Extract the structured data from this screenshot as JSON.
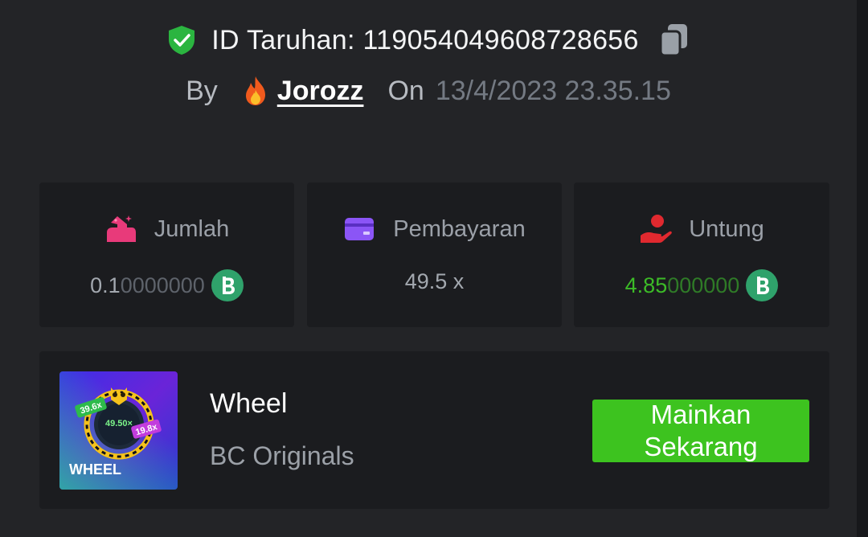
{
  "bet": {
    "id_label": "ID Taruhan: ",
    "id_value": "119054049608728656",
    "by_label": "By",
    "username": "Jorozz",
    "on_label": "On",
    "datetime": "13/4/2023 23.35.15"
  },
  "stats": {
    "amount": {
      "label": "Jumlah",
      "value_strong": "0.1",
      "value_faint": "0000000",
      "coin_icon": "bc-coin-icon"
    },
    "payout": {
      "label": "Pembayaran",
      "value": "49.5 x"
    },
    "profit": {
      "label": "Untung",
      "value_strong": "4.85",
      "value_faint": "000000",
      "coin_icon": "bc-coin-icon"
    }
  },
  "game": {
    "name": "Wheel",
    "provider": "BC Originals",
    "play_label": "Mainkan Sekarang",
    "thumbnail": {
      "title": "WHEEL",
      "tag_left": "39.6x",
      "tag_right": "19.8x",
      "center_value": "49.50×"
    }
  },
  "colors": {
    "background": "#232427",
    "card": "#1b1c1f",
    "accent_green": "#3dc31f",
    "shield_green": "#2bb540",
    "profit_green": "#3cbb27",
    "amount_icon": "#e83a7a",
    "payout_icon": "#8b55f6",
    "profit_icon": "#e0292f"
  },
  "icons": [
    "verified-shield-icon",
    "copy-icon",
    "fire-icon",
    "bet-amount-icon",
    "wallet-card-icon",
    "profit-hand-icon",
    "bc-coin-icon"
  ]
}
